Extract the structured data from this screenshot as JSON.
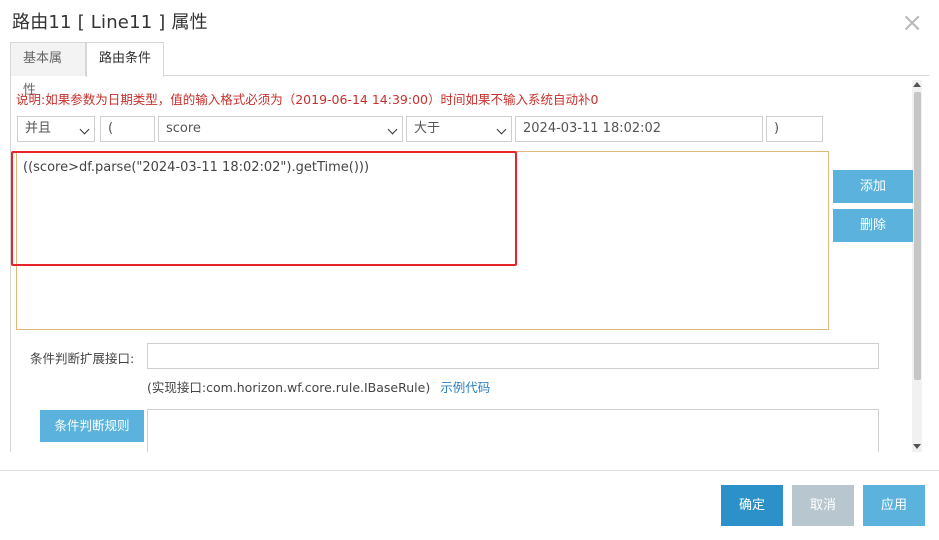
{
  "dialog": {
    "title": "路由11 [ Line11 ] 属性",
    "close_glyph": "×"
  },
  "tabs": [
    {
      "label": "基本属性",
      "active": false
    },
    {
      "label": "路由条件",
      "active": true
    }
  ],
  "note": "说明:如果参数为日期类型，值的输入格式必须为（2019-06-14 14:39:00）时间如果不输入系统自动补0",
  "condition": {
    "logic": "并且",
    "left_paren": "(",
    "field": "score",
    "operator": "大于",
    "value": "2024-03-11 18:02:02",
    "right_paren": ")"
  },
  "expression": "((score>df.parse(\"2024-03-11 18:02:02\").getTime()))",
  "side_buttons": {
    "add": "添加",
    "delete": "删除"
  },
  "extension": {
    "label": "条件判断扩展接口:",
    "value": "",
    "impl_text": "(实现接口:com.horizon.wf.core.rule.IBaseRule)",
    "sample_link": "示例代码"
  },
  "rule_button": "条件判断规则",
  "footer": {
    "ok": "确定",
    "cancel": "取消",
    "apply": "应用"
  },
  "colors": {
    "accent": "#5bb3dd",
    "primary": "#2d91c9",
    "warning_text": "#c9302c",
    "highlight_border": "#e8232a"
  }
}
